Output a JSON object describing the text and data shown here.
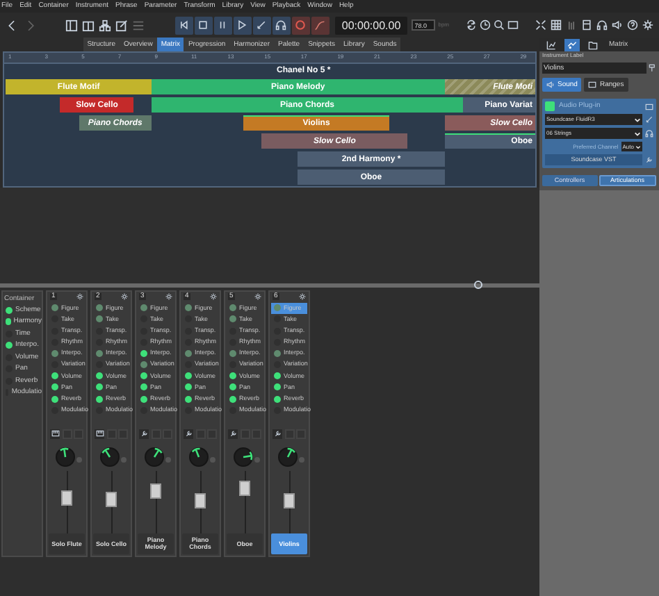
{
  "menu": [
    "File",
    "Edit",
    "Container",
    "Instrument",
    "Phrase",
    "Parameter",
    "Transform",
    "Library",
    "View",
    "Playback",
    "Window",
    "Help"
  ],
  "transport": {
    "time": "00:00:00.00",
    "tempo": "78.0",
    "tempo_unit": "bpm"
  },
  "view_tabs": [
    {
      "label": "Structure",
      "selected": false
    },
    {
      "label": "Overview",
      "selected": false
    },
    {
      "label": "Matrix",
      "selected": true
    },
    {
      "label": "Progression",
      "selected": false
    },
    {
      "label": "Harmonizer",
      "selected": false
    },
    {
      "label": "Palette",
      "selected": false
    },
    {
      "label": "Snippets",
      "selected": false
    },
    {
      "label": "Library",
      "selected": false
    },
    {
      "label": "Sounds",
      "selected": false
    }
  ],
  "panel_tabs": [
    {
      "kind": "chart",
      "selected": false
    },
    {
      "kind": "notes",
      "selected": true
    },
    {
      "kind": "folder",
      "selected": false
    },
    {
      "kind": "text",
      "label": "Matrix",
      "selected": false
    }
  ],
  "arrangement": {
    "ruler": [
      "1",
      "3",
      "5",
      "7",
      "9",
      "11",
      "13",
      "15",
      "17",
      "19",
      "21",
      "23",
      "25",
      "27",
      "29"
    ],
    "title": "Chanel No 5 *",
    "clips": [
      {
        "label": "Flute Motif",
        "color": "#c2b42c",
        "italic": false,
        "hatched": false,
        "marked": false
      },
      {
        "label": "Piano Melody",
        "color": "#2fb56f",
        "italic": false,
        "hatched": false,
        "marked": false
      },
      {
        "label": "Flute Moti",
        "color": "#8c8a5a",
        "italic": true,
        "hatched": true,
        "marked": false
      },
      {
        "label": "Slow Cello",
        "color": "#c42a2a",
        "italic": false,
        "hatched": false,
        "marked": false
      },
      {
        "label": "Piano Chords",
        "color": "#2fb56f",
        "italic": false,
        "hatched": false,
        "marked": false
      },
      {
        "label": "Piano Variat",
        "color": "#4c5d72",
        "italic": false,
        "hatched": false,
        "marked": false
      },
      {
        "label": "Piano Chords",
        "color": "#5f786a",
        "italic": true,
        "hatched": false,
        "marked": false
      },
      {
        "label": "Violins",
        "color": "#c47a24",
        "italic": false,
        "hatched": false,
        "marked": true
      },
      {
        "label": "Slow Cello",
        "color": "#8a5b5b",
        "italic": true,
        "hatched": false,
        "marked": false
      },
      {
        "label": "Slow Cello",
        "color": "#7a5c60",
        "italic": true,
        "hatched": false,
        "marked": false
      },
      {
        "label": "Oboe",
        "color": "#4c5d72",
        "italic": false,
        "hatched": false,
        "marked": true
      },
      {
        "label": "2nd Harmony *",
        "color": "#4c5d72",
        "italic": false,
        "hatched": false,
        "marked": false
      },
      {
        "label": "Oboe",
        "color": "#4c5d72",
        "italic": false,
        "hatched": false,
        "marked": false
      }
    ]
  },
  "inspector": {
    "caption": "Instrument Label",
    "instrument": "Violins",
    "buttons": [
      {
        "label": "Sound",
        "selected": true
      },
      {
        "label": "Ranges",
        "selected": false
      }
    ],
    "plugin": {
      "title": "Audio Plug-in",
      "bank": "Soundcase FluidR3",
      "program": "06 Strings",
      "channel_label": "Preferred Channel",
      "channel": "Auto",
      "device": "Soundcase VST"
    },
    "tabs": [
      {
        "label": "Controllers",
        "selected": false
      },
      {
        "label": "Articulations",
        "selected": true
      }
    ]
  },
  "mixer": {
    "container": {
      "title": "Container",
      "items": [
        {
          "label": "Scheme",
          "on": true
        },
        {
          "label": "Harmony",
          "on": true
        },
        {
          "label": "Time",
          "on": false
        },
        {
          "label": "Interpo.",
          "on": true
        },
        {
          "label": "Volume",
          "on": false
        },
        {
          "label": "Pan",
          "on": false
        },
        {
          "label": "Reverb",
          "on": false
        },
        {
          "label": "Modulatio",
          "on": false
        }
      ]
    },
    "strips": [
      {
        "number": "1",
        "kind": "keyboard",
        "name": "Solo Flute",
        "selected": false,
        "knob": {
          "level": 0.47
        },
        "fader": {
          "level": 0.62
        },
        "params": [
          {
            "label": "Figure",
            "on": true,
            "inherited": true,
            "selected": false
          },
          {
            "label": "Take",
            "on": false,
            "inherited": false,
            "selected": false
          },
          {
            "label": "Transp.",
            "on": false,
            "inherited": false,
            "selected": false
          },
          {
            "label": "Rhythm",
            "on": false,
            "inherited": false,
            "selected": false
          },
          {
            "label": "Interpo.",
            "on": true,
            "inherited": true,
            "selected": false
          },
          {
            "label": "Variation",
            "on": false,
            "inherited": false,
            "selected": false
          },
          {
            "label": "Volume",
            "on": true,
            "inherited": false,
            "selected": false
          },
          {
            "label": "Pan",
            "on": true,
            "inherited": false,
            "selected": false
          },
          {
            "label": "Reverb",
            "on": true,
            "inherited": false,
            "selected": false
          },
          {
            "label": "Modulatio",
            "on": false,
            "inherited": false,
            "selected": false
          }
        ]
      },
      {
        "number": "2",
        "kind": "keyboard",
        "name": "Solo Cello",
        "selected": false,
        "knob": {
          "level": 0.38
        },
        "fader": {
          "level": 0.58
        },
        "params": [
          {
            "label": "Figure",
            "on": true,
            "inherited": true,
            "selected": false
          },
          {
            "label": "Take",
            "on": true,
            "inherited": true,
            "selected": false
          },
          {
            "label": "Transp.",
            "on": false,
            "inherited": false,
            "selected": false
          },
          {
            "label": "Rhythm",
            "on": false,
            "inherited": false,
            "selected": false
          },
          {
            "label": "Interpo.",
            "on": true,
            "inherited": true,
            "selected": false
          },
          {
            "label": "Variation",
            "on": false,
            "inherited": false,
            "selected": false
          },
          {
            "label": "Volume",
            "on": true,
            "inherited": false,
            "selected": false
          },
          {
            "label": "Pan",
            "on": true,
            "inherited": false,
            "selected": false
          },
          {
            "label": "Reverb",
            "on": true,
            "inherited": false,
            "selected": false
          },
          {
            "label": "Modulatio",
            "on": false,
            "inherited": false,
            "selected": false
          }
        ]
      },
      {
        "number": "3",
        "kind": "wrench",
        "name": "Piano Melody",
        "selected": false,
        "knob": {
          "level": 0.62
        },
        "fader": {
          "level": 0.75
        },
        "params": [
          {
            "label": "Figure",
            "on": true,
            "inherited": true,
            "selected": false
          },
          {
            "label": "Take",
            "on": false,
            "inherited": false,
            "selected": false
          },
          {
            "label": "Transp.",
            "on": false,
            "inherited": false,
            "selected": false
          },
          {
            "label": "Rhythm",
            "on": false,
            "inherited": false,
            "selected": false
          },
          {
            "label": "Interpo.",
            "on": true,
            "inherited": false,
            "selected": false
          },
          {
            "label": "Variation",
            "on": true,
            "inherited": true,
            "selected": false
          },
          {
            "label": "Volume",
            "on": true,
            "inherited": false,
            "selected": false
          },
          {
            "label": "Pan",
            "on": true,
            "inherited": false,
            "selected": false
          },
          {
            "label": "Reverb",
            "on": true,
            "inherited": false,
            "selected": false
          },
          {
            "label": "Modulatio",
            "on": false,
            "inherited": false,
            "selected": false
          }
        ]
      },
      {
        "number": "4",
        "kind": "wrench",
        "name": "Piano Chords",
        "selected": false,
        "knob": {
          "level": 0.42
        },
        "fader": {
          "level": 0.55
        },
        "params": [
          {
            "label": "Figure",
            "on": true,
            "inherited": true,
            "selected": false
          },
          {
            "label": "Take",
            "on": false,
            "inherited": false,
            "selected": false
          },
          {
            "label": "Transp.",
            "on": false,
            "inherited": false,
            "selected": false
          },
          {
            "label": "Rhythm",
            "on": false,
            "inherited": false,
            "selected": false
          },
          {
            "label": "Interpo.",
            "on": true,
            "inherited": true,
            "selected": false
          },
          {
            "label": "Variation",
            "on": false,
            "inherited": false,
            "selected": false
          },
          {
            "label": "Volume",
            "on": true,
            "inherited": false,
            "selected": false
          },
          {
            "label": "Pan",
            "on": true,
            "inherited": false,
            "selected": false
          },
          {
            "label": "Reverb",
            "on": true,
            "inherited": false,
            "selected": false
          },
          {
            "label": "Modulatio",
            "on": false,
            "inherited": false,
            "selected": false
          }
        ]
      },
      {
        "number": "5",
        "kind": "wrench",
        "name": "Oboe",
        "selected": false,
        "knob": {
          "level": 0.8
        },
        "fader": {
          "level": 0.8
        },
        "params": [
          {
            "label": "Figure",
            "on": true,
            "inherited": true,
            "selected": false
          },
          {
            "label": "Take",
            "on": true,
            "inherited": true,
            "selected": false
          },
          {
            "label": "Transp.",
            "on": false,
            "inherited": false,
            "selected": false
          },
          {
            "label": "Rhythm",
            "on": false,
            "inherited": false,
            "selected": false
          },
          {
            "label": "Interpo.",
            "on": true,
            "inherited": true,
            "selected": false
          },
          {
            "label": "Variation",
            "on": false,
            "inherited": false,
            "selected": false
          },
          {
            "label": "Volume",
            "on": true,
            "inherited": false,
            "selected": false
          },
          {
            "label": "Pan",
            "on": true,
            "inherited": false,
            "selected": false
          },
          {
            "label": "Reverb",
            "on": true,
            "inherited": false,
            "selected": false
          },
          {
            "label": "Modulatio",
            "on": false,
            "inherited": false,
            "selected": false
          }
        ]
      },
      {
        "number": "6",
        "kind": "wrench",
        "name": "Violins",
        "selected": true,
        "knob": {
          "level": 0.6
        },
        "fader": {
          "level": 0.55
        },
        "params": [
          {
            "label": "Figure",
            "on": true,
            "inherited": true,
            "selected": true
          },
          {
            "label": "Take",
            "on": false,
            "inherited": false,
            "selected": false
          },
          {
            "label": "Transp.",
            "on": false,
            "inherited": false,
            "selected": false
          },
          {
            "label": "Rhythm",
            "on": false,
            "inherited": false,
            "selected": false
          },
          {
            "label": "Interpo.",
            "on": true,
            "inherited": true,
            "selected": false
          },
          {
            "label": "Variation",
            "on": false,
            "inherited": false,
            "selected": false
          },
          {
            "label": "Volume",
            "on": true,
            "inherited": false,
            "selected": false
          },
          {
            "label": "Pan",
            "on": true,
            "inherited": false,
            "selected": false
          },
          {
            "label": "Reverb",
            "on": true,
            "inherited": false,
            "selected": false
          },
          {
            "label": "Modulatio",
            "on": false,
            "inherited": false,
            "selected": false
          }
        ]
      }
    ]
  }
}
